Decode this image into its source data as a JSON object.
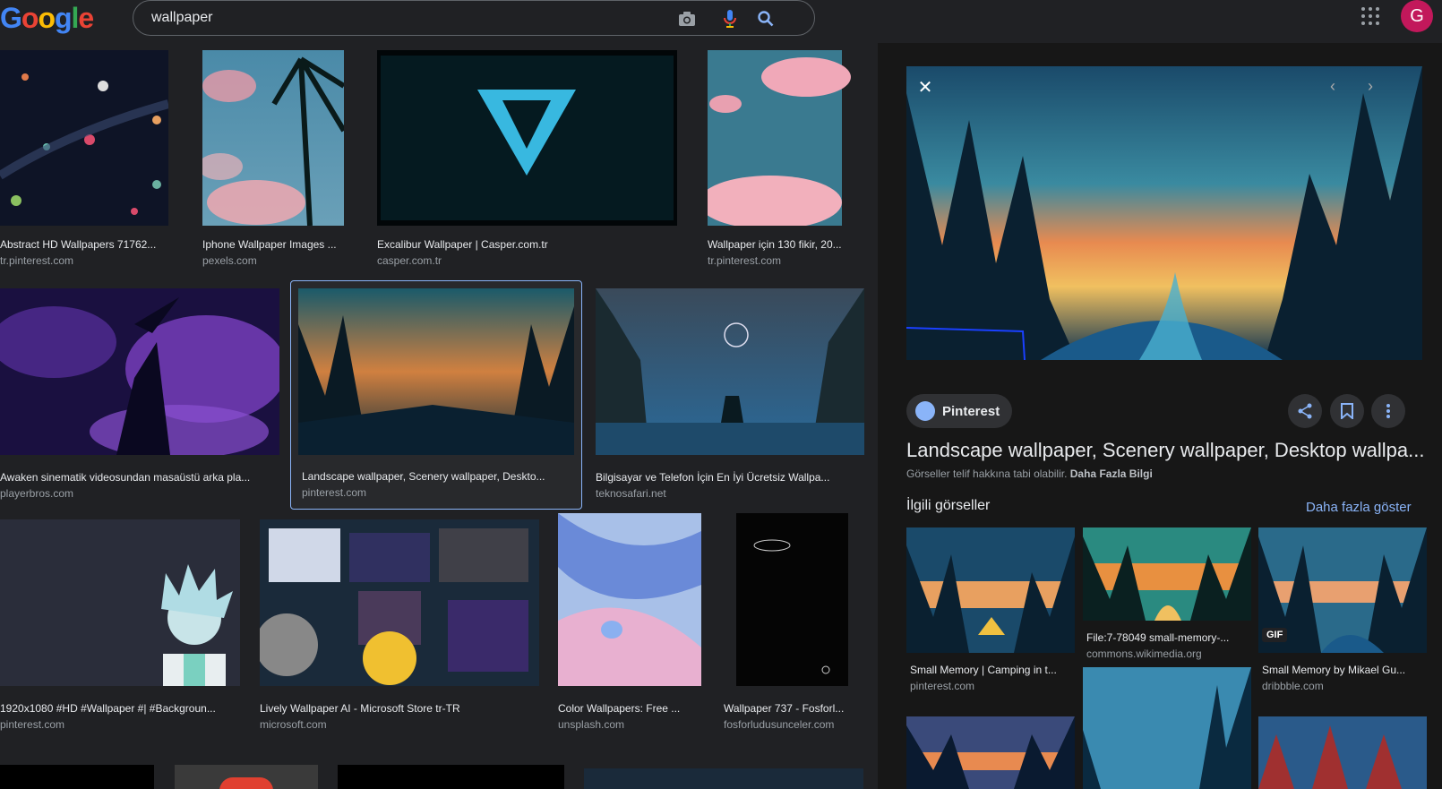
{
  "header": {
    "logo": "Google",
    "search_value": "wallpaper",
    "avatar_letter": "G"
  },
  "results": [
    {
      "caption": "Abstract HD Wallpapers 71762...",
      "source": "tr.pinterest.com"
    },
    {
      "caption": "Iphone Wallpaper Images ...",
      "source": "pexels.com"
    },
    {
      "caption": "Excalibur Wallpaper | Casper.com.tr",
      "source": "casper.com.tr"
    },
    {
      "caption": "Wallpaper için 130 fikir, 20...",
      "source": "tr.pinterest.com"
    },
    {
      "caption": "Awaken sinematik videosundan masaüstü arka pla...",
      "source": "playerbros.com"
    },
    {
      "caption": "Landscape wallpaper, Scenery wallpaper, Deskto...",
      "source": "pinterest.com"
    },
    {
      "caption": "Bilgisayar ve Telefon İçin En İyi Ücretsiz Wallpa...",
      "source": "teknosafari.net"
    },
    {
      "caption": "1920x1080 #HD #Wallpaper #| #Backgroun...",
      "source": "pinterest.com"
    },
    {
      "caption": "Lively Wallpaper AI - Microsoft Store tr-TR",
      "source": "microsoft.com"
    },
    {
      "caption": "Color Wallpapers: Free ...",
      "source": "unsplash.com"
    },
    {
      "caption": "Wallpaper 737 - Fosforl...",
      "source": "fosforludusunceler.com"
    }
  ],
  "panel": {
    "source_name": "Pinterest",
    "title": "Landscape wallpaper, Scenery wallpaper, Desktop wallpa...",
    "copyright": "Görseller telif hakkına tabi olabilir.",
    "learn_more": "Daha Fazla Bilgi",
    "related_heading": "İlgili görseller",
    "more_link": "Daha fazla göster",
    "related": [
      {
        "caption": "Small Memory | Camping in t...",
        "source": "pinterest.com"
      },
      {
        "caption": "File:7-78049 small-memory-...",
        "source": "commons.wikimedia.org"
      },
      {
        "caption": "Small Memory by Mikael Gu...",
        "source": "dribbble.com",
        "badge": "GIF"
      }
    ]
  }
}
